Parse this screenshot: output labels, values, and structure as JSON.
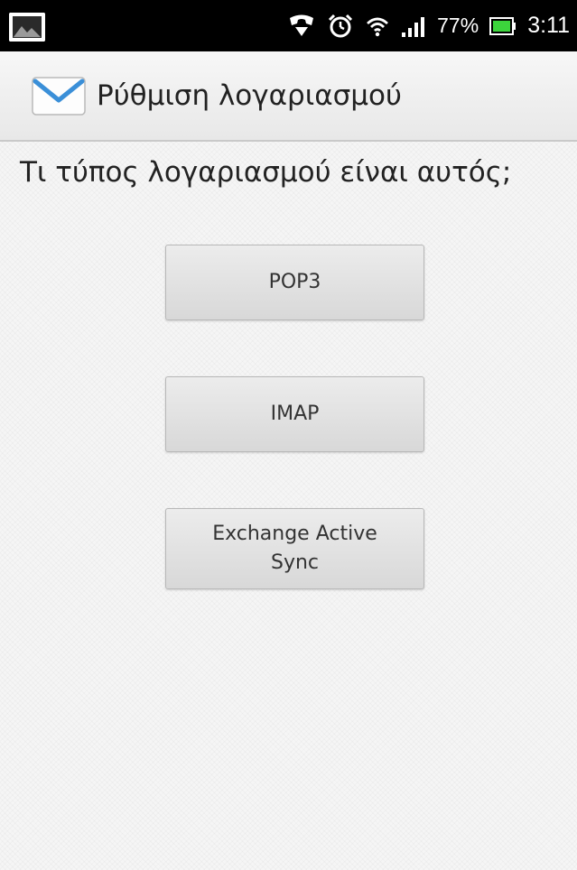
{
  "status_bar": {
    "battery_percent": "77%",
    "time": "3:11",
    "icons": [
      "photo-notification-icon",
      "call-notification-icon",
      "alarm-icon",
      "wifi-icon",
      "signal-icon",
      "battery-icon"
    ]
  },
  "app_bar": {
    "icon": "email-envelope-icon",
    "title": "Ρύθμιση λογαριασμού"
  },
  "main": {
    "question": "Τι τύπος λογαριασμού είναι αυτός;",
    "buttons": [
      {
        "label": "POP3"
      },
      {
        "label": "IMAP"
      },
      {
        "label": "Exchange Active Sync"
      }
    ]
  },
  "colors": {
    "status_bar": "#000000",
    "app_bar": "#eeeeee",
    "background": "#f5f5f5",
    "envelope_blue": "#3a8fd8",
    "battery_green": "#3cd43c"
  }
}
